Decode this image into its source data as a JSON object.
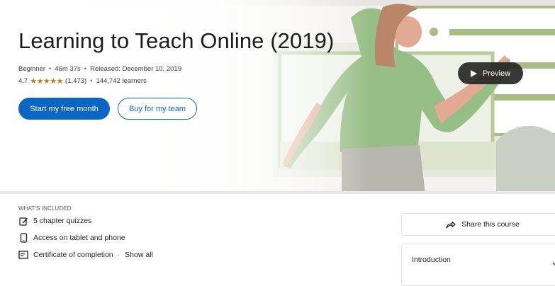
{
  "course": {
    "title": "Learning to Teach Online (2019)",
    "level": "Beginner",
    "duration": "46m 37s",
    "released": "Released: December 10, 2019",
    "rating": "4.7",
    "stars": "★★★★★",
    "rating_count": "(1,473)",
    "learners": "144,742 learners"
  },
  "buttons": {
    "primary": "Start my free month",
    "secondary": "Buy for my team",
    "preview": "Preview"
  },
  "included": {
    "heading": "WHAT'S INCLUDED",
    "items": [
      {
        "label": "5 chapter quizzes",
        "icon": "quiz-edit-icon"
      },
      {
        "label": "Access on tablet and phone",
        "icon": "tablet-phone-icon"
      },
      {
        "label": "Certificate of completion",
        "icon": "certificate-icon"
      }
    ],
    "show_all": "Show all"
  },
  "sidebar": {
    "share": "Share this course",
    "toc_first": "Introduction"
  },
  "colors": {
    "brand_blue": "#0a66c2",
    "star_gold": "#c37d16",
    "illustration_green": "#a8bd86"
  }
}
